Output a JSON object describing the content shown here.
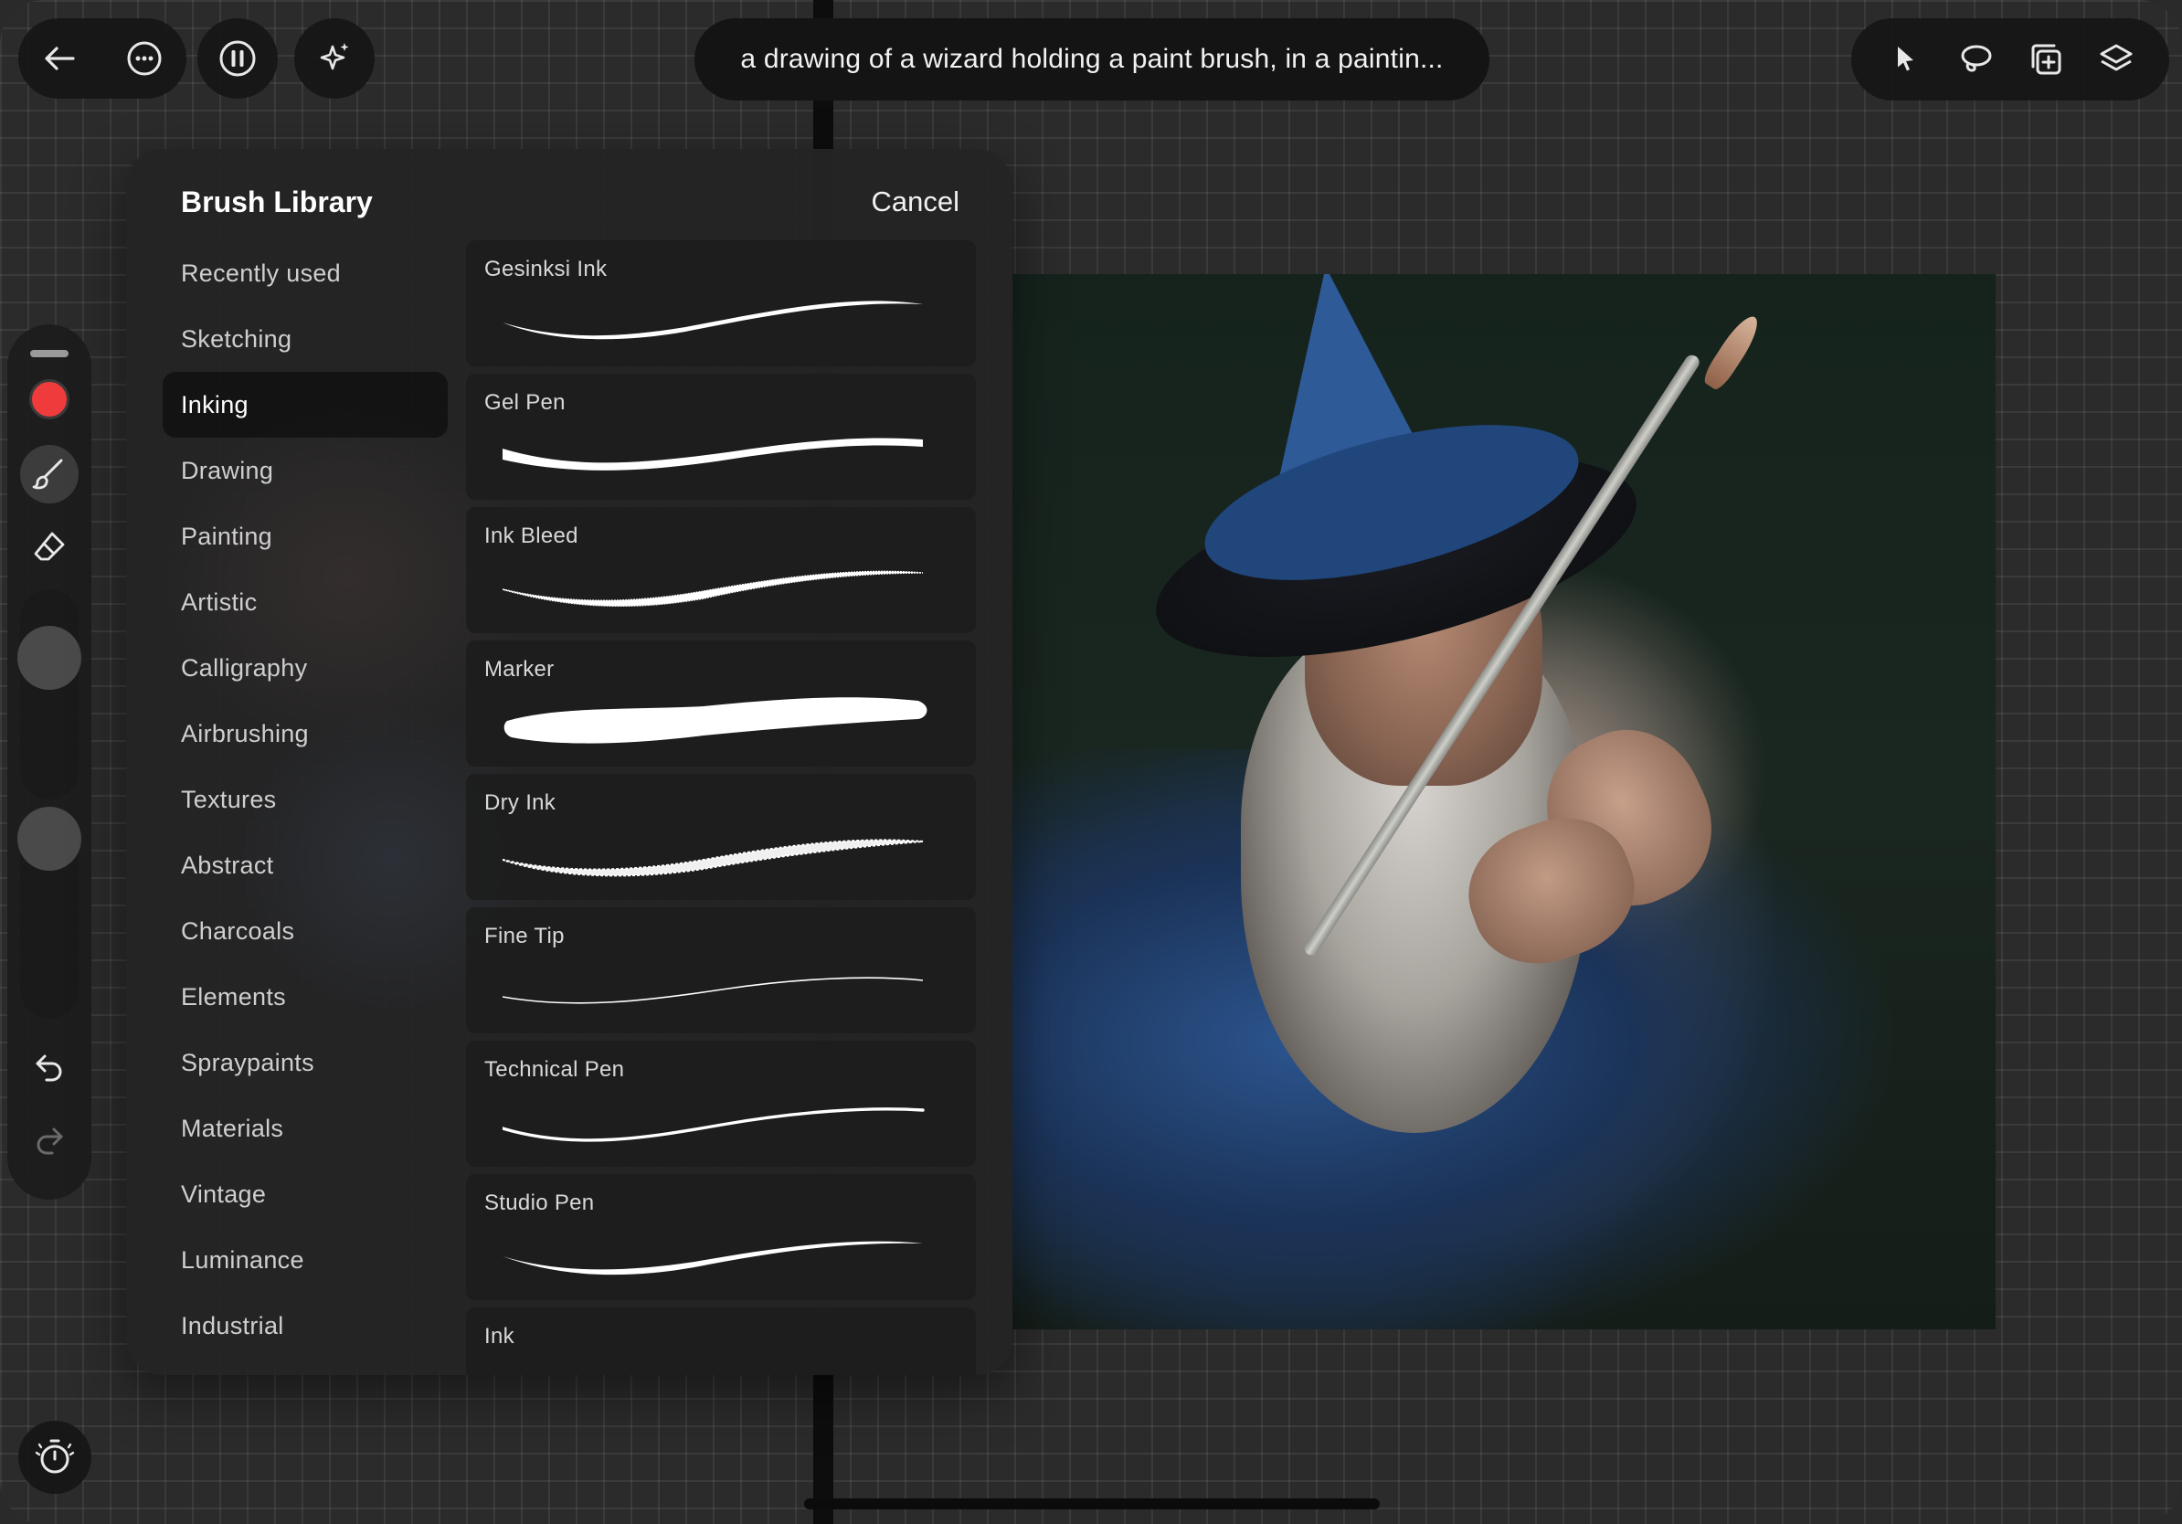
{
  "toolbar": {
    "prompt_text": "a drawing of a wizard holding a paint brush, in a paintin..."
  },
  "brush_library": {
    "title": "Brush Library",
    "cancel_label": "Cancel",
    "categories": [
      "Recently used",
      "Sketching",
      "Inking",
      "Drawing",
      "Painting",
      "Artistic",
      "Calligraphy",
      "Airbrushing",
      "Textures",
      "Abstract",
      "Charcoals",
      "Elements",
      "Spraypaints",
      "Materials",
      "Vintage",
      "Luminance",
      "Industrial"
    ],
    "selected_category": "Inking",
    "brushes": [
      "Gesinksi Ink",
      "Gel Pen",
      "Ink Bleed",
      "Marker",
      "Dry Ink",
      "Fine Tip",
      "Technical Pen",
      "Studio Pen",
      "Ink"
    ]
  },
  "colors": {
    "current_color": "#ef3b3b"
  }
}
